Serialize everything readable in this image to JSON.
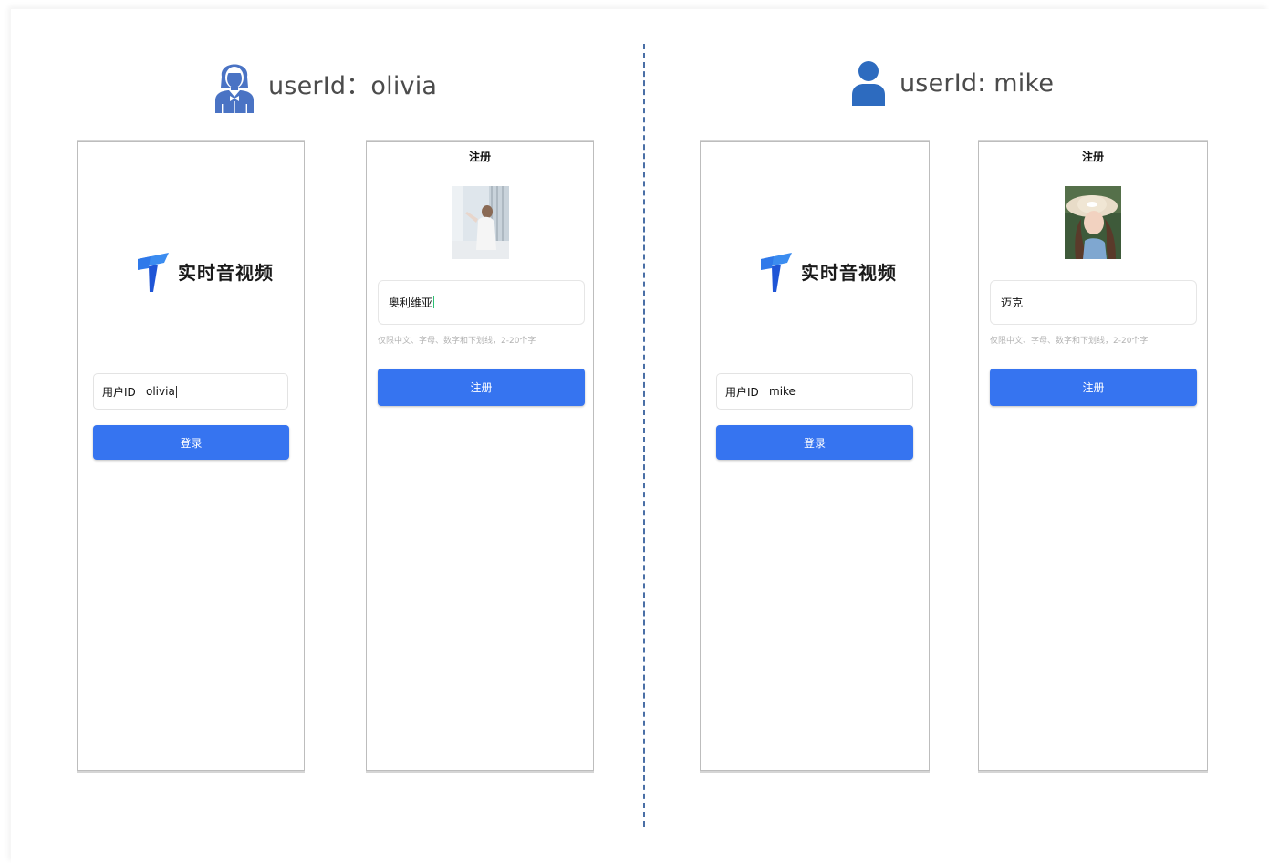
{
  "left_user": {
    "header_label": "userId：olivia",
    "icon": "woman-user-icon",
    "login_screen": {
      "logo_text": "实时音视频",
      "field_label": "用户ID",
      "field_value": "olivia",
      "button_label": "登录"
    },
    "register_screen": {
      "title": "注册",
      "name_value": "奥利维亚",
      "hint": "仅限中文、字母、数字和下划线，2-20个字",
      "button_label": "注册"
    }
  },
  "right_user": {
    "header_label": "userId: mike",
    "icon": "man-user-icon",
    "login_screen": {
      "logo_text": "实时音视频",
      "field_label": "用户ID",
      "field_value": "mike",
      "button_label": "登录"
    },
    "register_screen": {
      "title": "注册",
      "name_value": "迈克",
      "hint": "仅限中文、字母、数字和下划线，2-20个字",
      "button_label": "注册"
    }
  },
  "colors": {
    "primary_button": "#3674f0",
    "user_icon": "#4a73c4",
    "divider": "#4a6fa6"
  }
}
